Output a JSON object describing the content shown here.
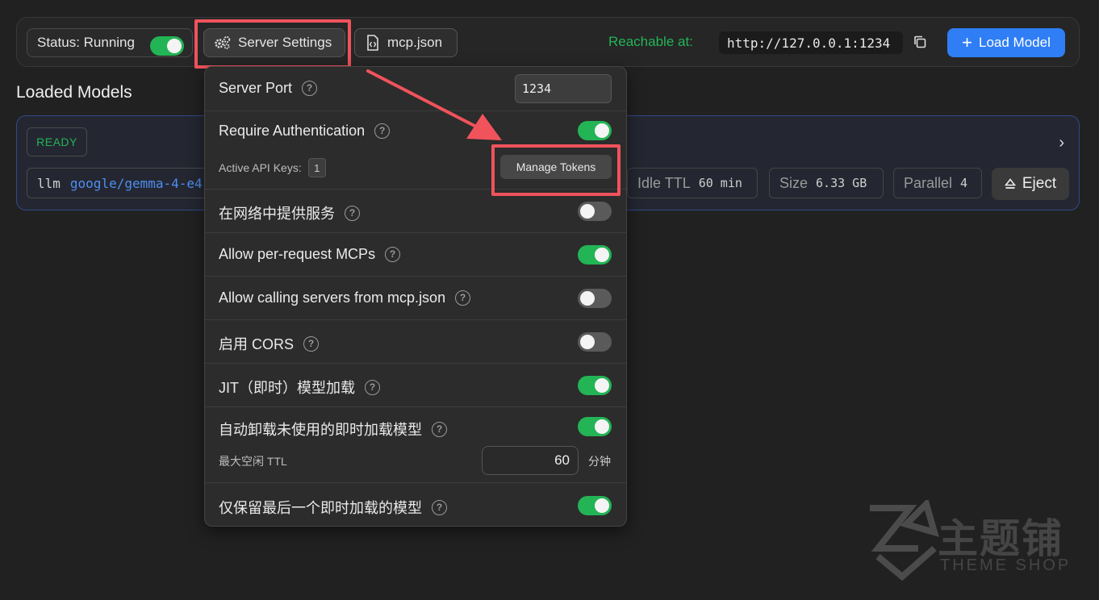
{
  "topbar": {
    "status_label": "Status: Running",
    "status_on": true,
    "server_settings_label": "Server Settings",
    "mcp_label": "mcp.json",
    "reachable_label": "Reachable at:",
    "url": "http://127.0.0.1:1234",
    "load_model_label": "Load Model",
    "load_model_plus": "+"
  },
  "section_title": "Loaded Models",
  "model": {
    "status": "READY",
    "type": "llm",
    "name": "google/gemma-4-e4",
    "idle_ttl_label": "Idle TTL",
    "idle_ttl_value": "60 min",
    "size_label": "Size",
    "size_value": "6.33 GB",
    "parallel_label": "Parallel",
    "parallel_value": "4",
    "eject_label": "Eject",
    "chevron": "›"
  },
  "settings": {
    "server_port_label": "Server Port",
    "server_port_value": "1234",
    "require_auth_label": "Require Authentication",
    "require_auth_on": true,
    "active_keys_label": "Active API Keys:",
    "active_keys_count": "1",
    "manage_tokens_label": "Manage Tokens",
    "serve_network_label": "在网络中提供服务",
    "serve_network_on": false,
    "per_request_mcp_label": "Allow per-request MCPs",
    "per_request_mcp_on": true,
    "mcp_json_servers_label": "Allow calling servers from mcp.json",
    "mcp_json_servers_on": false,
    "cors_label": "启用 CORS",
    "cors_on": false,
    "jit_label": "JIT（即时）模型加载",
    "jit_on": true,
    "auto_unload_label": "自动卸载未使用的即时加载模型",
    "auto_unload_on": true,
    "max_idle_ttl_label": "最大空闲 TTL",
    "max_idle_ttl_value": "60",
    "max_idle_ttl_unit": "分钟",
    "keep_last_label": "仅保留最后一个即时加载的模型",
    "keep_last_on": true,
    "help_glyph": "?"
  },
  "watermark": {
    "title": "主题铺",
    "subtitle": "THEME SHOP"
  },
  "colors": {
    "accent_green": "#23b455",
    "accent_blue": "#2f7ef5",
    "highlight_red": "#f0535c"
  }
}
